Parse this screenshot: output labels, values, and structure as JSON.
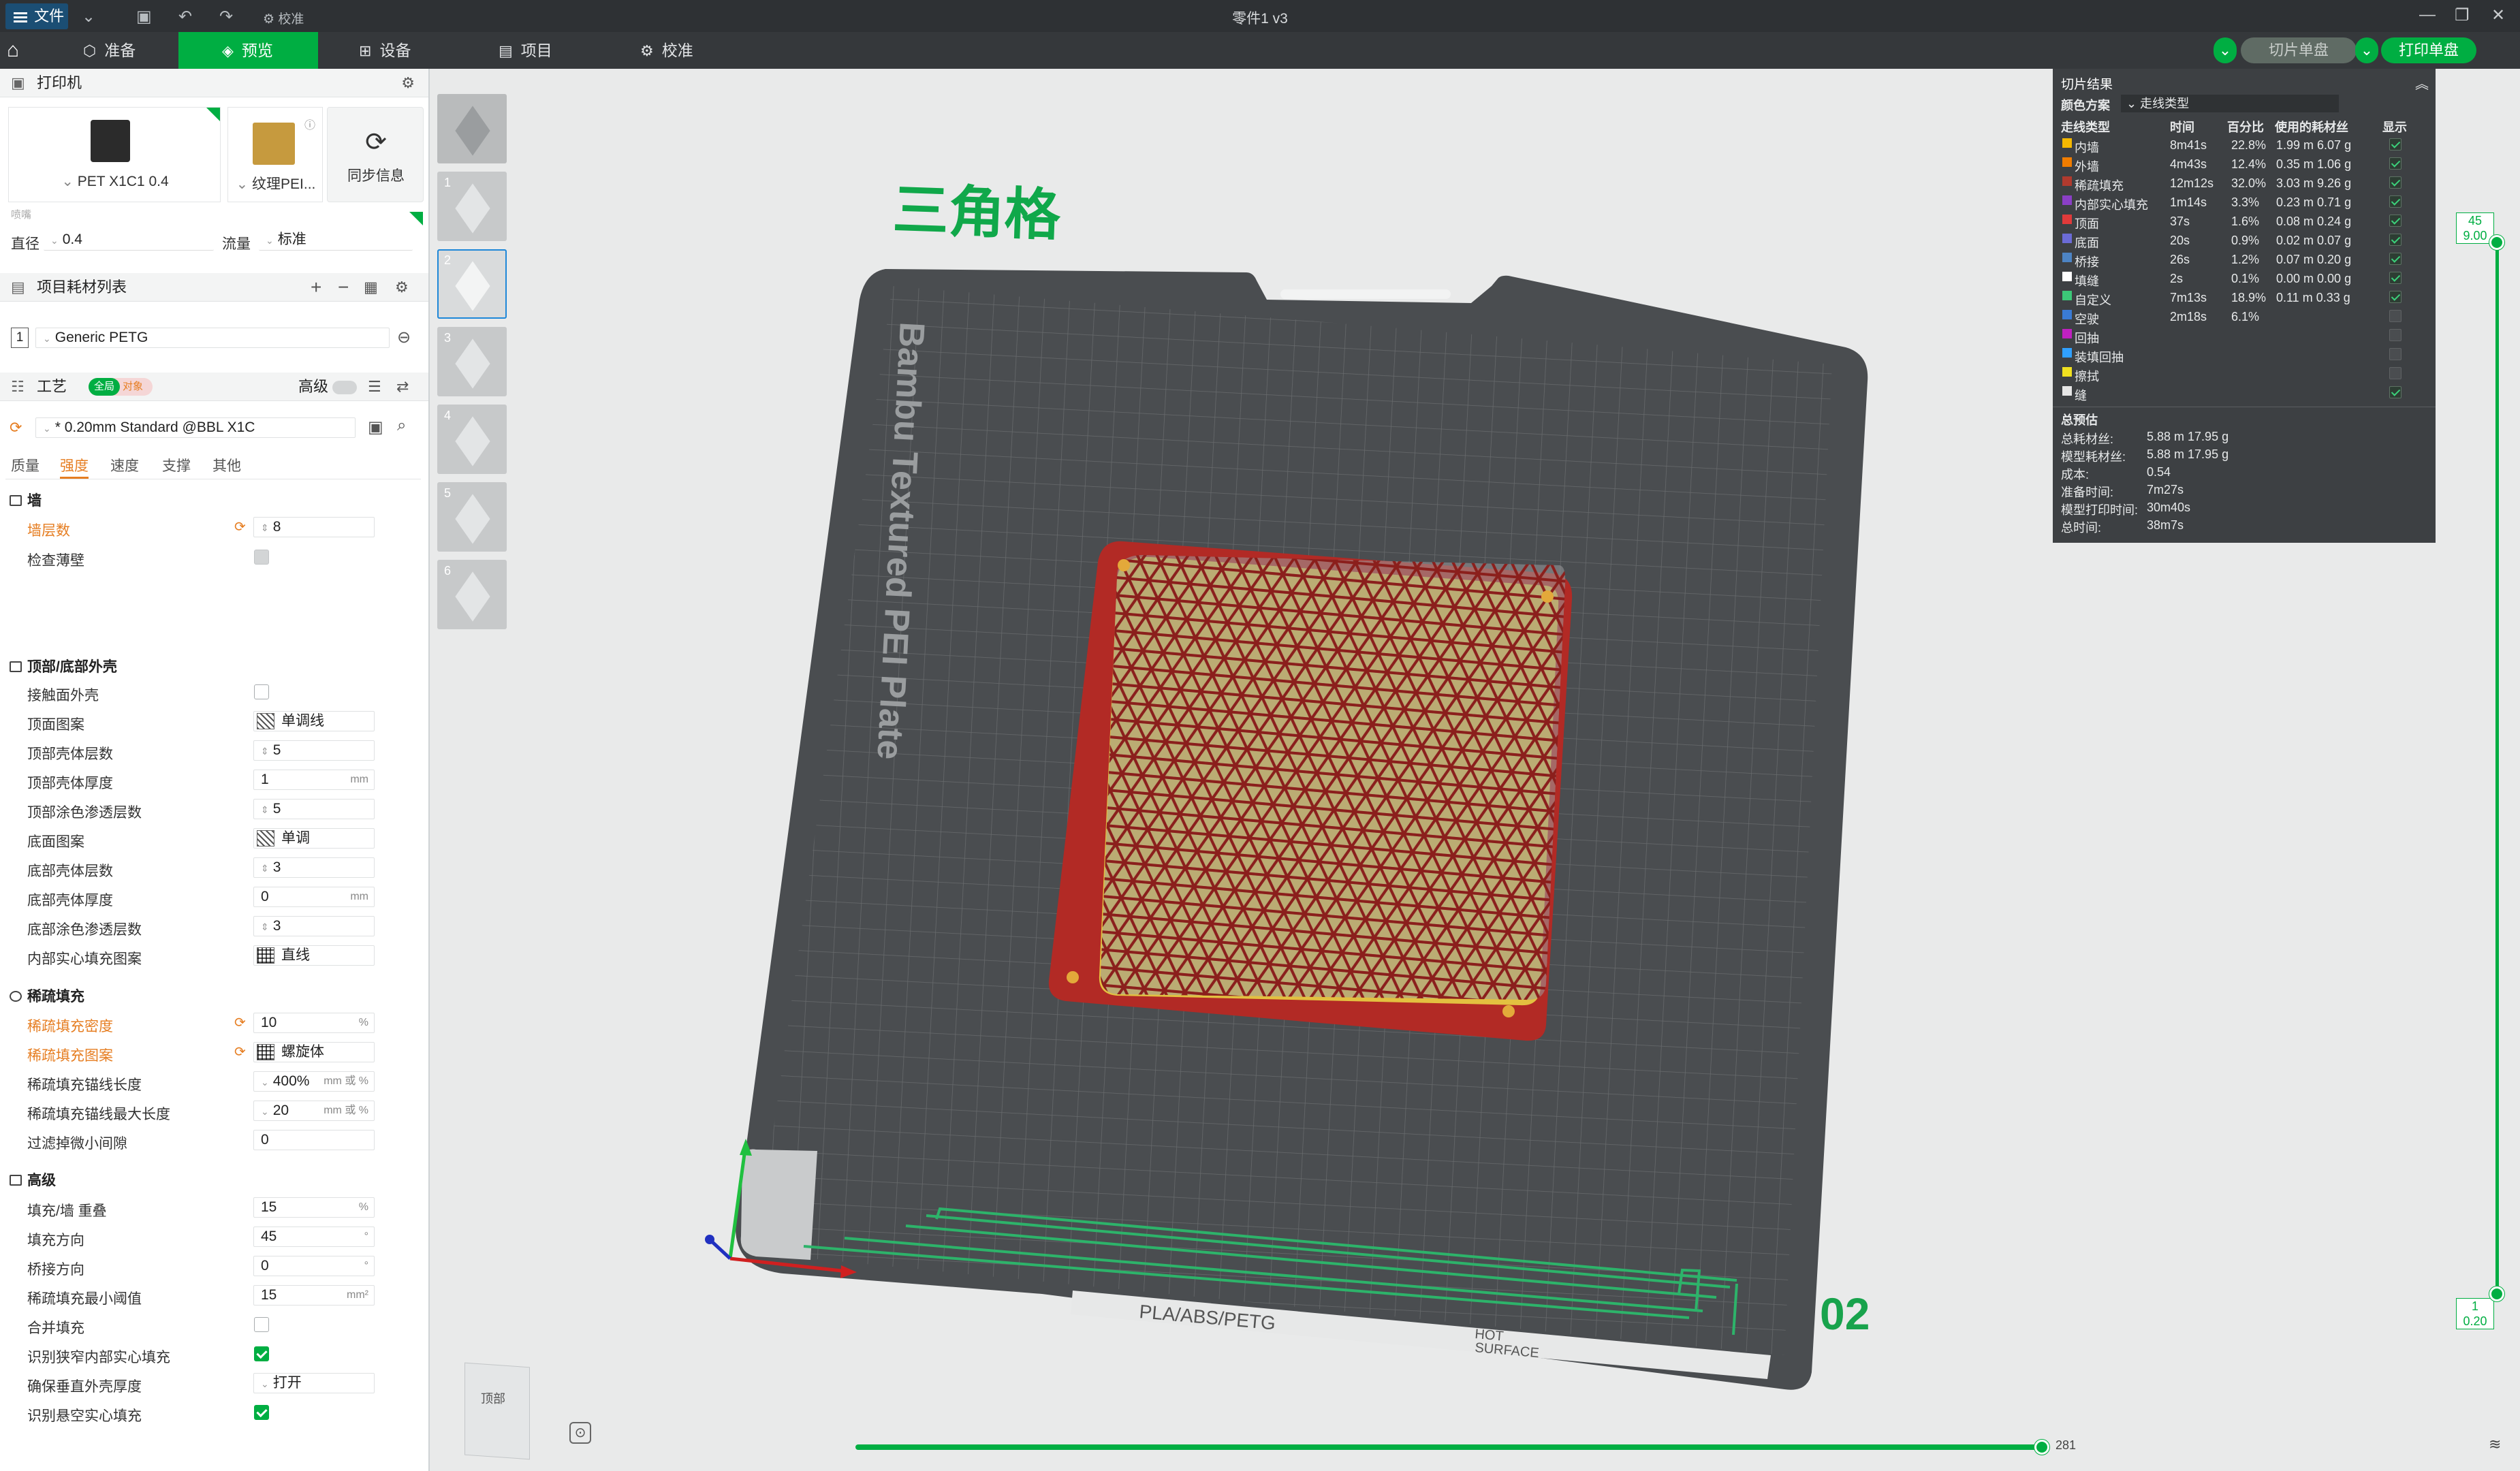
{
  "titlebar": {
    "file_label": "文件",
    "calibrate_label": "校准",
    "window_title": "零件1 v3"
  },
  "nav": {
    "tabs": [
      {
        "label": "准备",
        "icon": "cube-icon"
      },
      {
        "label": "预览",
        "icon": "layers-icon",
        "active": true
      },
      {
        "label": "设备",
        "icon": "device-icon"
      },
      {
        "label": "项目",
        "icon": "project-icon"
      },
      {
        "label": "校准",
        "icon": "calibrate-icon"
      }
    ],
    "slice_plate": "切片单盘",
    "print_plate": "打印单盘"
  },
  "printer": {
    "section_title": "打印机",
    "printer_name": "PET X1C1 0.4",
    "plate_name": "纹理PEI...",
    "sync_label": "同步信息",
    "nozzle_heading": "喷嘴",
    "diameter_label": "直径",
    "diameter_value": "0.4",
    "flow_label": "流量",
    "flow_value": "标准"
  },
  "filament": {
    "section_title": "项目耗材列表",
    "slot": "1",
    "name": "Generic PETG"
  },
  "process": {
    "section_title": "工艺",
    "toggle_global": "全局",
    "toggle_object": "对象",
    "advanced_label": "高级",
    "profile": "* 0.20mm Standard @BBL X1C",
    "tabs": [
      "质量",
      "强度",
      "速度",
      "支撑",
      "其他"
    ],
    "active_tab": "强度"
  },
  "settings": {
    "wall_group": "墙",
    "wall_loops_label": "墙层数",
    "wall_loops": "8",
    "detect_thin_wall": "检查薄壁",
    "shell_group": "顶部/底部外壳",
    "interface_shells": "接触面外壳",
    "top_pattern_label": "顶面图案",
    "top_pattern": "单调线",
    "top_layers_label": "顶部壳体层数",
    "top_layers": "5",
    "top_thickness_label": "顶部壳体厚度",
    "top_thickness": "1",
    "top_paint_label": "顶部涂色渗透层数",
    "top_paint": "5",
    "bottom_pattern_label": "底面图案",
    "bottom_pattern": "单调",
    "bottom_layers_label": "底部壳体层数",
    "bottom_layers": "3",
    "bottom_thickness_label": "底部壳体厚度",
    "bottom_thickness": "0",
    "bottom_paint_label": "底部涂色渗透层数",
    "bottom_paint": "3",
    "internal_solid_label": "内部实心填充图案",
    "internal_solid": "直线",
    "infill_group": "稀疏填充",
    "density_label": "稀疏填充密度",
    "density": "10",
    "infill_pattern_label": "稀疏填充图案",
    "infill_pattern": "螺旋体",
    "anchor_label": "稀疏填充锚线长度",
    "anchor": "400%",
    "anchor_max_label": "稀疏填充锚线最大长度",
    "anchor_max": "20",
    "filter_gaps_label": "过滤掉微小间隙",
    "filter_gaps": "0",
    "advanced_group": "高级",
    "overlap_label": "填充/墙 重叠",
    "overlap": "15",
    "infill_dir_label": "填充方向",
    "infill_dir": "45",
    "bridge_dir_label": "桥接方向",
    "bridge_dir": "0",
    "min_area_label": "稀疏填充最小阈值",
    "min_area": "15",
    "combine_label": "合并填充",
    "narrow_solid_label": "识别狭窄内部实心填充",
    "vertical_shell_label": "确保垂直外壳厚度",
    "vertical_shell": "打开",
    "overhang_solid_label": "识别悬空实心填充",
    "unit_mm": "mm",
    "unit_pct": "%",
    "unit_mm_or_pct": "mm 或 %",
    "unit_deg": "°",
    "unit_mm2": "mm²"
  },
  "viewport": {
    "annotation": "三角格",
    "plate_label": "Bambu Textured PEI Plate",
    "plate_materials": "PLA/ABS/PETG",
    "hot_surface_1": "HOT",
    "hot_surface_2": "SURFACE",
    "plate_number": "02",
    "view_cube_label": "顶部",
    "plates": [
      "1",
      "2",
      "3",
      "4",
      "5",
      "6"
    ],
    "selected_plate": "2"
  },
  "layer_slider": {
    "top_layer": "45",
    "top_height": "9.00",
    "bottom_layer": "1",
    "bottom_height": "0.20",
    "move_value": "281"
  },
  "result": {
    "title": "切片结果",
    "scheme_label": "颜色方案",
    "scheme_value": "走线类型",
    "headers": [
      "走线类型",
      "时间",
      "百分比",
      "使用的耗材丝",
      "显示"
    ],
    "rows": [
      {
        "type": "内墙",
        "color": "#f5b800",
        "time": "8m41s",
        "pct": "22.8%",
        "used": "1.99 m  6.07 g",
        "show": true
      },
      {
        "type": "外墙",
        "color": "#f07d00",
        "time": "4m43s",
        "pct": "12.4%",
        "used": "0.35 m  1.06 g",
        "show": true
      },
      {
        "type": "稀疏填充",
        "color": "#b03a2e",
        "time": "12m12s",
        "pct": "32.0%",
        "used": "3.03 m  9.26 g",
        "show": true
      },
      {
        "type": "内部实心填充",
        "color": "#8a3fc6",
        "time": "1m14s",
        "pct": "3.3%",
        "used": "0.23 m  0.71 g",
        "show": true
      },
      {
        "type": "顶面",
        "color": "#e03a3a",
        "time": "37s",
        "pct": "1.6%",
        "used": "0.08 m  0.24 g",
        "show": true
      },
      {
        "type": "底面",
        "color": "#6b6bd6",
        "time": "20s",
        "pct": "0.9%",
        "used": "0.02 m  0.07 g",
        "show": true
      },
      {
        "type": "桥接",
        "color": "#4d84c4",
        "time": "26s",
        "pct": "1.2%",
        "used": "0.07 m  0.20 g",
        "show": true
      },
      {
        "type": "填缝",
        "color": "#ffffff",
        "time": "2s",
        "pct": "0.1%",
        "used": "0.00 m  0.00 g",
        "show": true
      },
      {
        "type": "自定义",
        "color": "#3cc878",
        "time": "7m13s",
        "pct": "18.9%",
        "used": "0.11 m  0.33 g",
        "show": true
      },
      {
        "type": "空驶",
        "color": "#3a7bd5",
        "time": "2m18s",
        "pct": "6.1%",
        "used": "",
        "show": false
      },
      {
        "type": "回抽",
        "color": "#c020c0",
        "time": "",
        "pct": "",
        "used": "",
        "show": false
      },
      {
        "type": "装填回抽",
        "color": "#30a0ff",
        "time": "",
        "pct": "",
        "used": "",
        "show": false
      },
      {
        "type": "擦拭",
        "color": "#f0e020",
        "time": "",
        "pct": "",
        "used": "",
        "show": false
      },
      {
        "type": "缝",
        "color": "#e6e6e6",
        "time": "",
        "pct": "",
        "used": "",
        "show": true
      }
    ],
    "summary_title": "总预估",
    "summary": [
      {
        "label": "总耗材丝:",
        "value": "5.88 m    17.95 g"
      },
      {
        "label": "模型耗材丝:",
        "value": "5.88 m    17.95 g"
      },
      {
        "label": "成本:",
        "value": "0.54"
      },
      {
        "label": "准备时间:",
        "value": "7m27s"
      },
      {
        "label": "模型打印时间:",
        "value": "30m40s"
      },
      {
        "label": "总时间:",
        "value": "38m7s"
      }
    ]
  },
  "colors": {
    "accent": "#00ae42",
    "plate": "#4a4d50",
    "model_red": "#b22a25",
    "model_yellow": "#e3c040",
    "modified": "#e67e22"
  }
}
